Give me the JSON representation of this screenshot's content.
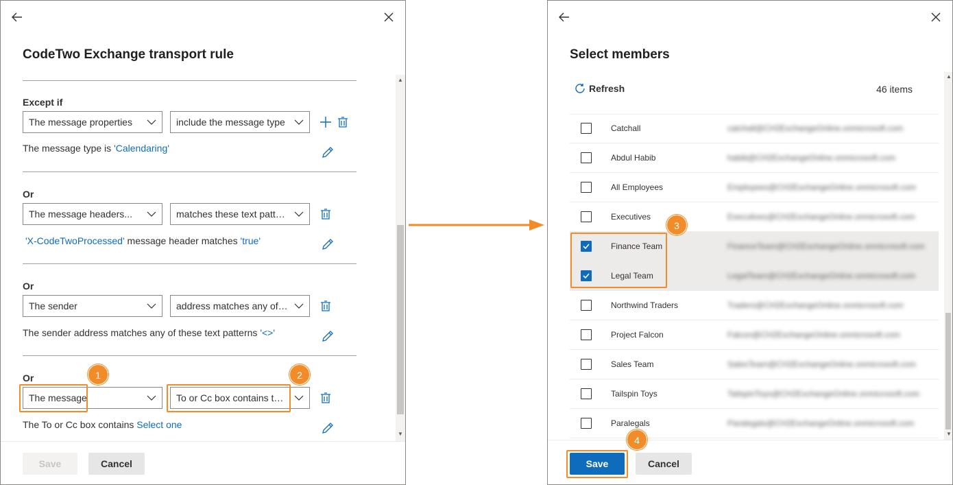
{
  "left": {
    "title": "CodeTwo Exchange transport rule",
    "sections": [
      {
        "label": "Except if",
        "field1": "The message properties",
        "field2": "include the message type",
        "desc_prefix": "The message type is ",
        "desc_value": "'Calendaring'"
      },
      {
        "label": "Or",
        "field1": "The message headers...",
        "field2": "matches these text patte...",
        "desc_value1": "'X-CodeTwoProcessed'",
        "desc_mid": " message header matches ",
        "desc_value2": "'true'"
      },
      {
        "label": "Or",
        "field1": "The sender",
        "field2": "address matches any of t...",
        "desc_prefix": "The sender address matches any of these text patterns ",
        "desc_value": "'<>'"
      },
      {
        "label": "Or",
        "field1": "The message",
        "field2": "To or Cc box contains thi...",
        "desc_prefix": "The To or Cc box contains ",
        "desc_link": "Select one"
      }
    ],
    "save_label": "Save",
    "cancel_label": "Cancel"
  },
  "right": {
    "title": "Select members",
    "refresh_label": "Refresh",
    "count_label": "46 items",
    "members": [
      {
        "name": "Catchall",
        "email": "catchall@CH2ExchangeOnline.onmicrosoft.com",
        "checked": false
      },
      {
        "name": "Abdul Habib",
        "email": "habib@CH2ExchangeOnline.onmicrosoft.com",
        "checked": false
      },
      {
        "name": "All Employees",
        "email": "Employees@CH2ExchangeOnline.onmicrosoft.com",
        "checked": false
      },
      {
        "name": "Executives",
        "email": "Executives@CH2ExchangeOnline.onmicrosoft.com",
        "checked": false
      },
      {
        "name": "Finance Team",
        "email": "FinanceTeam@CH2ExchangeOnline.onmicrosoft.com",
        "checked": true
      },
      {
        "name": "Legal Team",
        "email": "LegalTeam@CH2ExchangeOnline.onmicrosoft.com",
        "checked": true
      },
      {
        "name": "Northwind Traders",
        "email": "Traders@CH2ExchangeOnline.onmicrosoft.com",
        "checked": false
      },
      {
        "name": "Project Falcon",
        "email": "Falcon@CH2ExchangeOnline.onmicrosoft.com",
        "checked": false
      },
      {
        "name": "Sales Team",
        "email": "SalesTeam@CH2ExchangeOnline.onmicrosoft.com",
        "checked": false
      },
      {
        "name": "Tailspin Toys",
        "email": "TailspinToys@CH2ExchangeOnline.onmicrosoft.com",
        "checked": false
      },
      {
        "name": "Paralegals",
        "email": "Paralegals@CH2ExchangeOnline.onmicrosoft.com",
        "checked": false
      }
    ],
    "save_label": "Save",
    "cancel_label": "Cancel"
  },
  "badges": [
    "1",
    "2",
    "3",
    "4"
  ],
  "colors": {
    "accent": "#0f6cbd",
    "highlight": "#f28c28"
  }
}
